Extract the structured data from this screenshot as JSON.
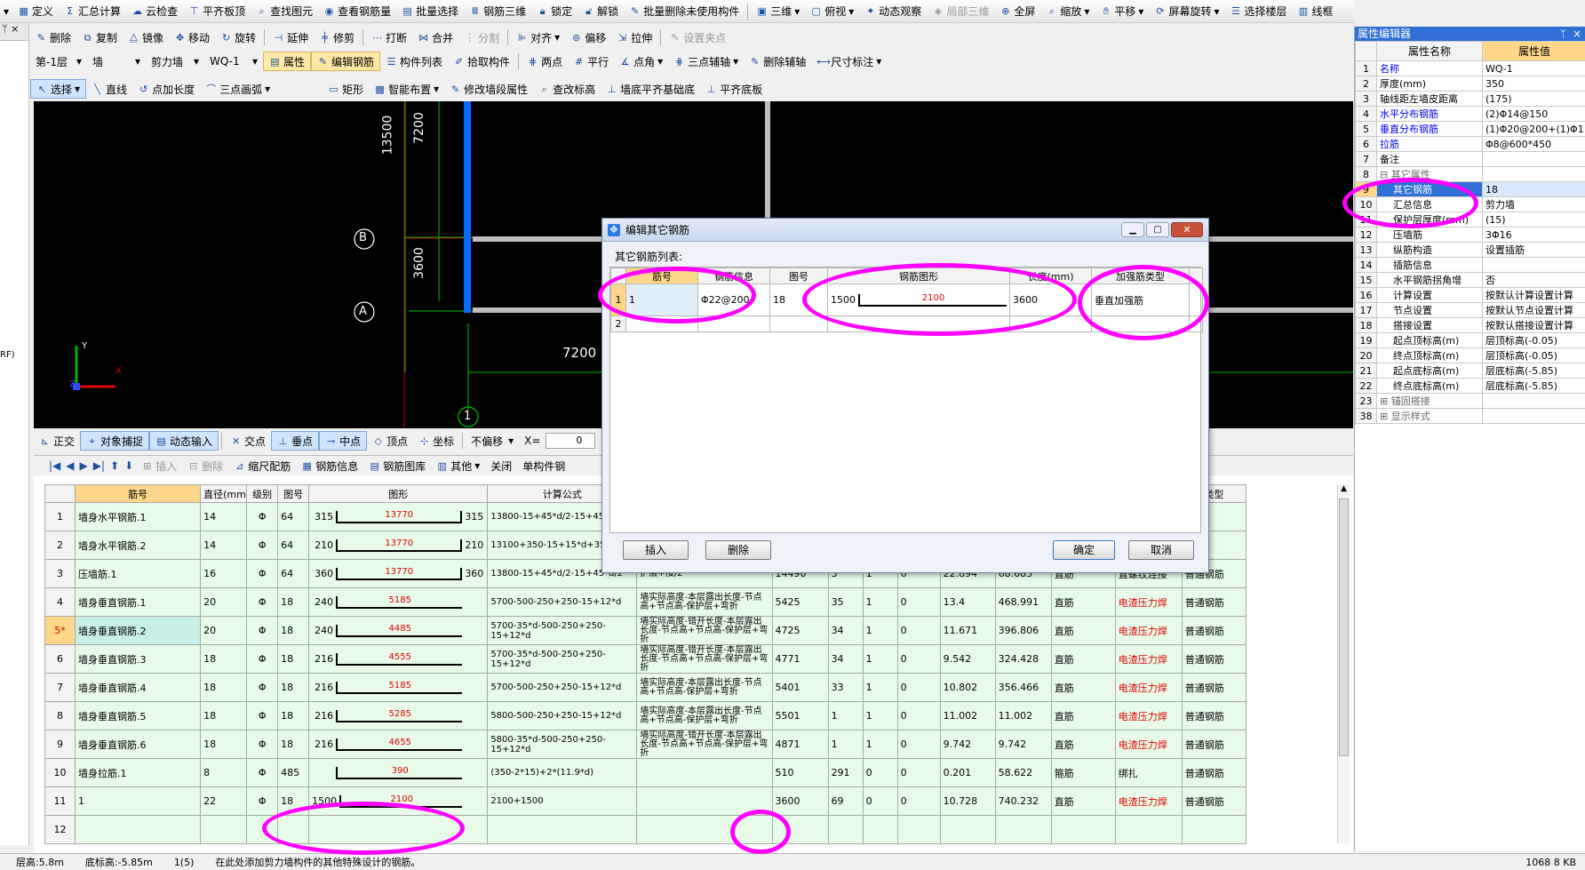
{
  "toolbar1": [
    "定义",
    "汇总计算",
    "云检查",
    "平齐板顶",
    "查找图元",
    "查看钢筋量",
    "批量选择",
    "钢筋三维",
    "锁定",
    "解锁",
    "批量删除未使用构件",
    "三维",
    "俯视",
    "动态观察",
    "局部三维",
    "全屏",
    "缩放",
    "平移",
    "屏幕旋转",
    "选择楼层",
    "线框"
  ],
  "toolbar2": [
    "删除",
    "复制",
    "镜像",
    "移动",
    "旋转",
    "延伸",
    "修剪",
    "打断",
    "合并",
    "分割",
    "对齐",
    "偏移",
    "拉伸",
    "设置夹点"
  ],
  "toolbar3": {
    "floor": "第-1层",
    "type": "墙",
    "sub": "剪力墙",
    "name": "WQ-1",
    "items": [
      "属性",
      "编辑钢筋",
      "构件列表",
      "拾取构件",
      "两点",
      "平行",
      "点角",
      "三点辅轴",
      "删除辅轴",
      "尺寸标注"
    ]
  },
  "toolbar4": [
    "选择",
    "直线",
    "点加长度",
    "三点画弧",
    "矩形",
    "智能布置",
    "修改墙段属性",
    "查改标高",
    "墙底平齐基础底",
    "平齐底板"
  ],
  "left_stub": "RF)",
  "cad": {
    "dim_13500": "13500",
    "dim_7200_v": "7200",
    "dim_3600": "3600",
    "dim_7200_h": "7200",
    "axis_b": "B",
    "axis_a": "A",
    "axis_1": "1",
    "ucs_y": "Y",
    "ucs_x": "X",
    "ucs_z": "Z"
  },
  "snap_bar": {
    "items": [
      "正交",
      "对象捕捉",
      "动态输入",
      "交点",
      "垂点",
      "中点",
      "顶点",
      "坐标"
    ],
    "offset": "不偏移",
    "x_label": "X=",
    "x_value": "0"
  },
  "grid_toolbar": [
    "插入",
    "删除",
    "缩尺配筋",
    "钢筋信息",
    "钢筋图库",
    "其他",
    "关闭",
    "单构件钢"
  ],
  "grid_headers": [
    "筋号",
    "直径(mm)",
    "级别",
    "图号",
    "图形",
    "计算公式",
    "",
    "",
    "",
    "",
    "",
    "",
    "",
    "",
    "",
    "类型"
  ],
  "grid_rows": [
    {
      "no": "1",
      "name": "墙身水平钢筋.1",
      "dia": "14",
      "grade": "Φ",
      "fig_no": "64",
      "left": "315",
      "len": "13770",
      "right": "315",
      "formula": "13800-15+45*d/2-15+45",
      "desc": "",
      "total": "",
      "count": "",
      "a": "",
      "b": "",
      "w1": "",
      "w2": "",
      "shape": "",
      "joint": "",
      "type": "筋"
    },
    {
      "no": "2",
      "name": "墙身水平钢筋.2",
      "dia": "14",
      "grade": "Φ",
      "fig_no": "64",
      "left": "210",
      "len": "13770",
      "right": "210",
      "formula": "13100+350-15+15*d+35 5*d",
      "desc": "",
      "total": "",
      "count": "",
      "a": "",
      "b": "",
      "w1": "",
      "w2": "",
      "shape": "",
      "joint": "",
      "type": "筋"
    },
    {
      "no": "3",
      "name": "压墙筋.1",
      "dia": "16",
      "grade": "Φ",
      "fig_no": "64",
      "left": "360",
      "len": "13770",
      "right": "360",
      "formula": "13800-15+45*d/2-15+45*d/2",
      "desc": "护层+接/2",
      "total": "14490",
      "count": "3",
      "a": "1",
      "b": "0",
      "w1": "22.894",
      "w2": "68.683",
      "shape": "直筋",
      "joint": "直螺纹连接",
      "type": "普通钢筋"
    },
    {
      "no": "4",
      "name": "墙身垂直钢筋.1",
      "dia": "20",
      "grade": "Φ",
      "fig_no": "18",
      "left": "240",
      "len": "5185",
      "right": "",
      "formula": "5700-500-250+250-15+12*d",
      "desc": "墙实际高度-本层露出长度-节点高+节点高-保护层+弯折",
      "total": "5425",
      "count": "35",
      "a": "1",
      "b": "0",
      "w1": "13.4",
      "w2": "468.991",
      "shape": "直筋",
      "joint": "电渣压力焊",
      "type": "普通钢筋"
    },
    {
      "no": "5*",
      "name": "墙身垂直钢筋.2",
      "dia": "20",
      "grade": "Φ",
      "fig_no": "18",
      "left": "240",
      "len": "4485",
      "right": "",
      "formula": "5700-35*d-500-250+250-15+12*d",
      "desc": "墙实际高度-错开长度-本层露出长度-节点高+节点高-保护层+弯折",
      "total": "4725",
      "count": "34",
      "a": "1",
      "b": "0",
      "w1": "11.671",
      "w2": "396.806",
      "shape": "直筋",
      "joint": "电渣压力焊",
      "type": "普通钢筋"
    },
    {
      "no": "6",
      "name": "墙身垂直钢筋.3",
      "dia": "18",
      "grade": "Φ",
      "fig_no": "18",
      "left": "216",
      "len": "4555",
      "right": "",
      "formula": "5700-35*d-500-250+250-15+12*d",
      "desc": "墙实际高度-错开长度-本层露出长度-节点高+节点高-保护层+弯折",
      "total": "4771",
      "count": "34",
      "a": "1",
      "b": "0",
      "w1": "9.542",
      "w2": "324.428",
      "shape": "直筋",
      "joint": "电渣压力焊",
      "type": "普通钢筋"
    },
    {
      "no": "7",
      "name": "墙身垂直钢筋.4",
      "dia": "18",
      "grade": "Φ",
      "fig_no": "18",
      "left": "216",
      "len": "5185",
      "right": "",
      "formula": "5700-500-250+250-15+12*d",
      "desc": "墙实际高度-本层露出长度-节点高+节点高-保护层+弯折",
      "total": "5401",
      "count": "33",
      "a": "1",
      "b": "0",
      "w1": "10.802",
      "w2": "356.466",
      "shape": "直筋",
      "joint": "电渣压力焊",
      "type": "普通钢筋"
    },
    {
      "no": "8",
      "name": "墙身垂直钢筋.5",
      "dia": "18",
      "grade": "Φ",
      "fig_no": "18",
      "left": "216",
      "len": "5285",
      "right": "",
      "formula": "5800-500-250+250-15+12*d",
      "desc": "墙实际高度-本层露出长度-节点高+节点高-保护层+弯折",
      "total": "5501",
      "count": "1",
      "a": "1",
      "b": "0",
      "w1": "11.002",
      "w2": "11.002",
      "shape": "直筋",
      "joint": "电渣压力焊",
      "type": "普通钢筋"
    },
    {
      "no": "9",
      "name": "墙身垂直钢筋.6",
      "dia": "18",
      "grade": "Φ",
      "fig_no": "18",
      "left": "216",
      "len": "4655",
      "right": "",
      "formula": "5800-35*d-500-250+250-15+12*d",
      "desc": "墙实际高度-错开长度-本层露出长度-节点高+节点高-保护层+弯折",
      "total": "4871",
      "count": "1",
      "a": "1",
      "b": "0",
      "w1": "9.742",
      "w2": "9.742",
      "shape": "直筋",
      "joint": "电渣压力焊",
      "type": "普通钢筋"
    },
    {
      "no": "10",
      "name": "墙身拉筋.1",
      "dia": "8",
      "grade": "Φ",
      "fig_no": "485",
      "left": "",
      "len": "390",
      "right": "",
      "formula": "(350-2*15)+2*(11.9*d)",
      "desc": "",
      "total": "510",
      "count": "291",
      "a": "0",
      "b": "0",
      "w1": "0.201",
      "w2": "58.622",
      "shape": "箍筋",
      "joint": "绑扎",
      "type": "普通钢筋"
    },
    {
      "no": "11",
      "name": "1",
      "dia": "22",
      "grade": "Φ",
      "fig_no": "18",
      "left": "1500",
      "len": "2100",
      "right": "",
      "formula": "2100+1500",
      "desc": "",
      "total": "3600",
      "count": "69",
      "a": "0",
      "b": "0",
      "w1": "10.728",
      "w2": "740.232",
      "shape": "直筋",
      "joint": "电渣压力焊",
      "type": "普通钢筋"
    },
    {
      "no": "12",
      "name": "",
      "dia": "",
      "grade": "",
      "fig_no": "",
      "left": "",
      "len": "",
      "right": "",
      "formula": "",
      "desc": "",
      "total": "",
      "count": "",
      "a": "",
      "b": "",
      "w1": "",
      "w2": "",
      "shape": "",
      "joint": "",
      "type": ""
    }
  ],
  "status_bar": {
    "floor_h": "层高:5.8m",
    "bottom": "底标高:-5.85m",
    "sel": "1(5)",
    "hint": "在此处添加剪力墙构件的其他特殊设计的钢筋。",
    "coords": "1068 8 KB"
  },
  "props": {
    "title": "属性编辑器",
    "headers": [
      "属性名称",
      "属性值"
    ],
    "rows": [
      {
        "id": "1",
        "name": "名称",
        "value": "WQ-1",
        "blue": true
      },
      {
        "id": "2",
        "name": "厚度(mm)",
        "value": "350",
        "blue": false
      },
      {
        "id": "3",
        "name": "轴线距左墙皮距离",
        "value": "(175)",
        "blue": false
      },
      {
        "id": "4",
        "name": "水平分布钢筋",
        "value": "(2)Φ14@150",
        "blue": true
      },
      {
        "id": "5",
        "name": "垂直分布钢筋",
        "value": "(1)Φ20@200+(1)Φ1",
        "blue": true
      },
      {
        "id": "6",
        "name": "拉筋",
        "value": "Φ8@600*450",
        "blue": true
      },
      {
        "id": "7",
        "name": "备注",
        "value": "",
        "blue": false
      },
      {
        "id": "8",
        "name": "其它属性",
        "value": "",
        "blue": false,
        "group": true
      },
      {
        "id": "9",
        "name": "其它钢筋",
        "value": "18",
        "blue": false,
        "sel": true
      },
      {
        "id": "10",
        "name": "汇总信息",
        "value": "剪力墙",
        "blue": false
      },
      {
        "id": "11",
        "name": "保护层厚度(mm)",
        "value": "(15)",
        "blue": false
      },
      {
        "id": "12",
        "name": "压墙筋",
        "value": "3Φ16",
        "blue": false
      },
      {
        "id": "13",
        "name": "纵筋构造",
        "value": "设置插筋",
        "blue": false
      },
      {
        "id": "14",
        "name": "插筋信息",
        "value": "",
        "blue": false
      },
      {
        "id": "15",
        "name": "水平钢筋拐角增",
        "value": "否",
        "blue": false
      },
      {
        "id": "16",
        "name": "计算设置",
        "value": "按默认计算设置计算",
        "blue": false
      },
      {
        "id": "17",
        "name": "节点设置",
        "value": "按默认节点设置计算",
        "blue": false
      },
      {
        "id": "18",
        "name": "搭接设置",
        "value": "按默认搭接设置计算",
        "blue": false
      },
      {
        "id": "19",
        "name": "起点顶标高(m)",
        "value": "层顶标高(-0.05)",
        "blue": false
      },
      {
        "id": "20",
        "name": "终点顶标高(m)",
        "value": "层顶标高(-0.05)",
        "blue": false
      },
      {
        "id": "21",
        "name": "起点底标高(m)",
        "value": "层底标高(-5.85)",
        "blue": false
      },
      {
        "id": "22",
        "name": "终点底标高(m)",
        "value": "层底标高(-5.85)",
        "blue": false
      },
      {
        "id": "23",
        "name": "锚固搭接",
        "value": "",
        "blue": false,
        "group": true
      },
      {
        "id": "38",
        "name": "显示样式",
        "value": "",
        "blue": false,
        "group": true
      }
    ]
  },
  "dialog": {
    "title": "编辑其它钢筋",
    "list_label": "其它钢筋列表:",
    "headers": [
      "筋号",
      "钢筋信息",
      "图号",
      "钢筋图形",
      "长度(mm)",
      "加强筋类型"
    ],
    "row": {
      "idx": "1",
      "no": "1",
      "info": "Φ22@200",
      "fig": "18",
      "left": "1500",
      "len": "2100",
      "length": "3600",
      "type": "垂直加强筋"
    },
    "row2_idx": "2",
    "insert": "插入",
    "delete": "删除",
    "ok": "确定",
    "cancel": "取消"
  },
  "colors": {
    "accent": "#ff00ff",
    "header": "#ffd78a",
    "rowbg": "#e8fbe8",
    "cad_bg": "#000000",
    "rebar_red": "#e00000"
  }
}
